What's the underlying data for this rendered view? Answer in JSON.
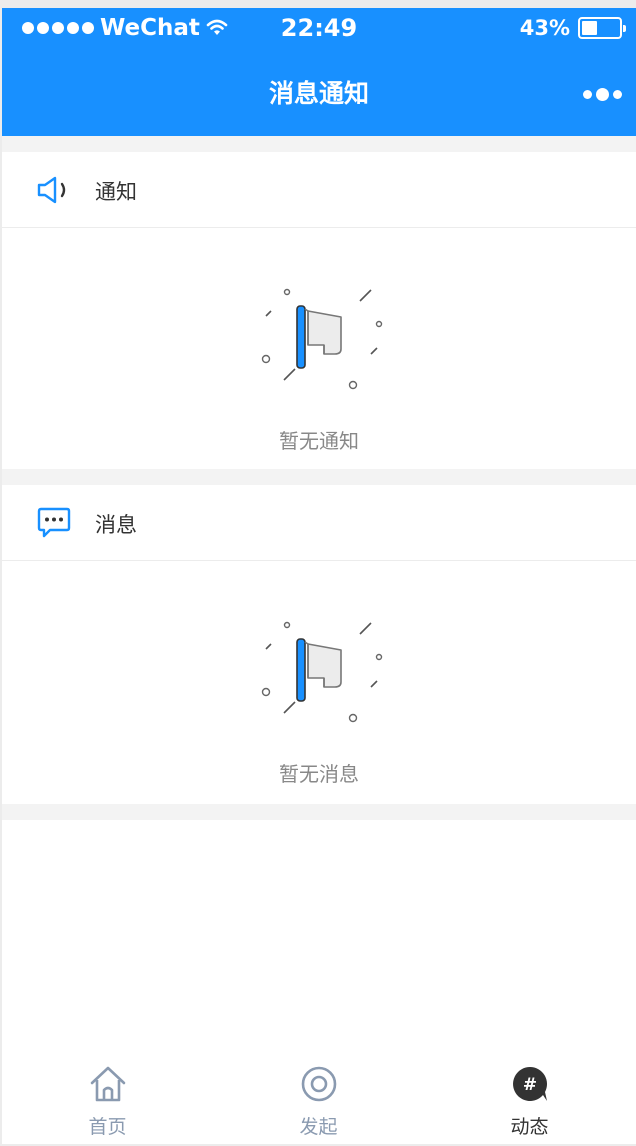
{
  "status_bar": {
    "carrier": "WeChat",
    "time": "22:49",
    "battery": "43%",
    "battery_level": 0.43
  },
  "nav": {
    "title": "消息通知",
    "more_icon": "more-dots-icon"
  },
  "sections": [
    {
      "title": "通知",
      "icon": "speaker-icon",
      "empty_text": "暂无通知",
      "empty_icon": "flag-icon"
    },
    {
      "title": "消息",
      "icon": "chat-bubble-icon",
      "empty_text": "暂无消息",
      "empty_icon": "flag-icon"
    }
  ],
  "tabs": [
    {
      "label": "首页",
      "icon": "home-icon",
      "active": false
    },
    {
      "label": "发起",
      "icon": "target-icon",
      "active": false
    },
    {
      "label": "动态",
      "icon": "hashtag-bubble-icon",
      "active": true
    }
  ],
  "colors": {
    "brand": "#1890ff",
    "tab_inactive": "#8a9ab0",
    "tab_active": "#333333",
    "background": "#f3f3f3"
  }
}
